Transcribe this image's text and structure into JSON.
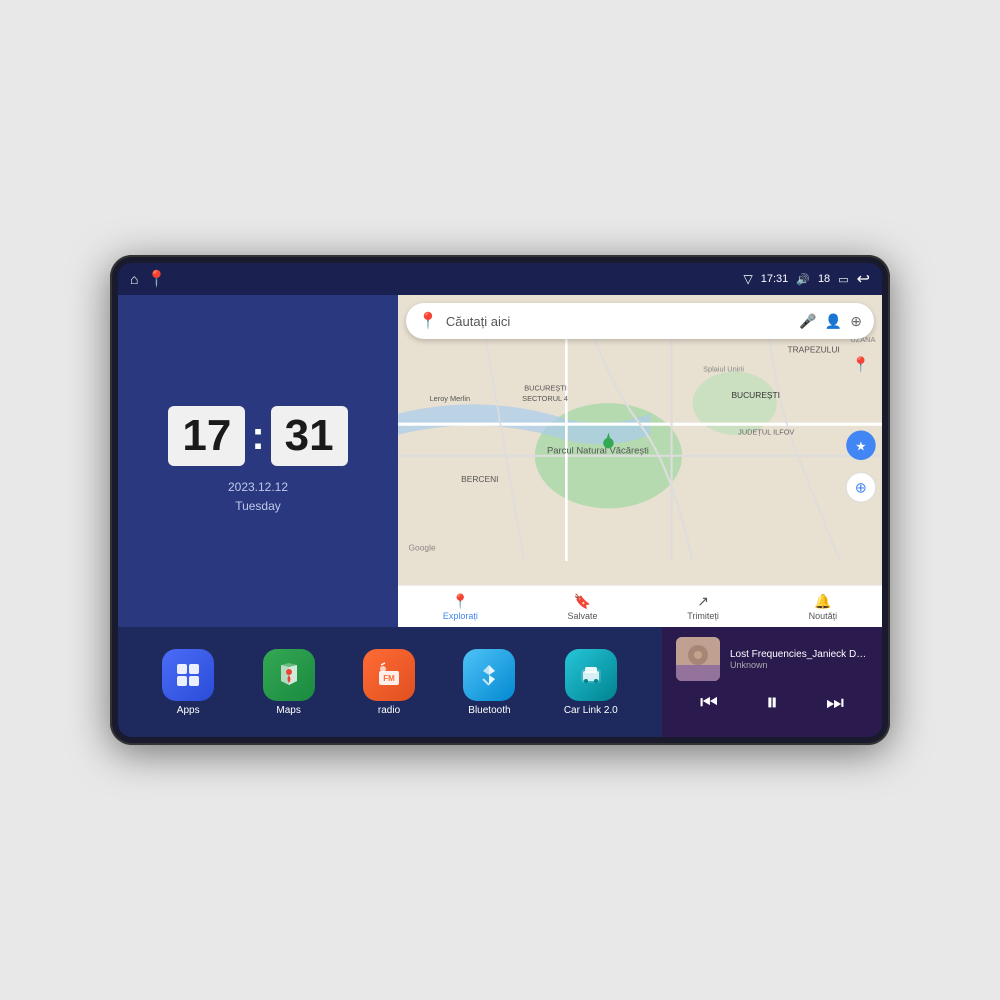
{
  "device": {
    "status_bar": {
      "left_icons": [
        "home-icon",
        "maps-pin-icon"
      ],
      "time": "17:31",
      "volume_icon": "🔊",
      "signal": "18",
      "battery_icon": "🔋",
      "back_icon": "↩"
    },
    "clock": {
      "hours": "17",
      "minutes": "31",
      "date": "2023.12.12",
      "day": "Tuesday"
    },
    "map": {
      "search_placeholder": "Căutați aici",
      "nav_items": [
        {
          "label": "Explorați",
          "active": true
        },
        {
          "label": "Salvate",
          "active": false
        },
        {
          "label": "Trimiteți",
          "active": false
        },
        {
          "label": "Noutăți",
          "active": false
        }
      ]
    },
    "apps": [
      {
        "id": "apps",
        "label": "Apps",
        "bg_class": "apps-bg",
        "icon": "⊞"
      },
      {
        "id": "maps",
        "label": "Maps",
        "bg_class": "maps-bg",
        "icon": "📍"
      },
      {
        "id": "radio",
        "label": "radio",
        "bg_class": "radio-bg",
        "icon": "📻"
      },
      {
        "id": "bluetooth",
        "label": "Bluetooth",
        "bg_class": "bluetooth-bg",
        "icon": "⬡"
      },
      {
        "id": "carlink",
        "label": "Car Link 2.0",
        "bg_class": "carlink-bg",
        "icon": "🚗"
      }
    ],
    "music": {
      "title": "Lost Frequencies_Janieck Devy-...",
      "artist": "Unknown",
      "controls": {
        "prev": "⏮",
        "play_pause": "⏸",
        "next": "⏭"
      }
    }
  }
}
